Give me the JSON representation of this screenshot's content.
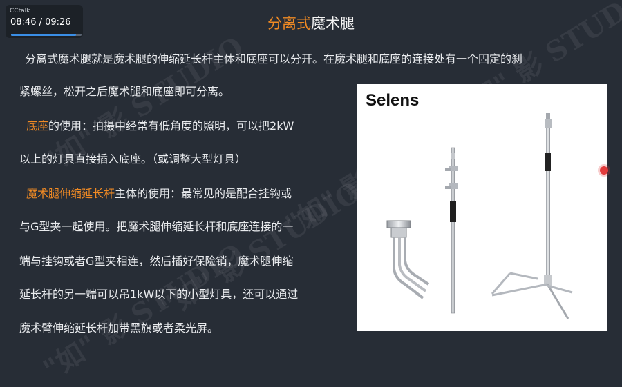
{
  "overlay": {
    "app_name": "CCtalk",
    "time": "08:46 / 09:26",
    "progress": 0.92
  },
  "watermark": {
    "text": "\"如\" 影 STUDIO"
  },
  "title": {
    "accent": "分离式",
    "rest": "魔术腿"
  },
  "paragraphs": {
    "p1_line1": "分离式魔术腿就是魔术腿的伸缩延长杆主体和底座可以分开。在魔术腿和底座的连接处有一个固定的刹",
    "p1_line2": "紧螺丝，松开之后魔术腿和底座即可分离。",
    "p2_accent": "底座",
    "p2_line1_rest": "的使用：拍摄中经常有低角度的照明，可以把2kW",
    "p2_line2": "以上的灯具直接插入底座。（或调整大型灯具）",
    "p3_accent": "魔术腿伸缩延长杆",
    "p3_line1_rest": "主体的使用：最常见的是配合挂钩或",
    "p3_line2": "与G型夹一起使用。把魔术腿伸缩延长杆和底座连接的一",
    "p3_line3": "端与挂钩或者G型夹相连，然后插好保险销，魔术腿伸缩",
    "p3_line4": "延长杆的另一端可以吊1kW以下的小型灯具，还可以通过",
    "p3_line5": "魔术臂伸缩延长杆加带黑旗或者柔光屏。"
  },
  "photo": {
    "brand": "Selens"
  },
  "colors": {
    "accent": "#f08a24",
    "background": "#272d36",
    "record": "#e23b3b"
  }
}
